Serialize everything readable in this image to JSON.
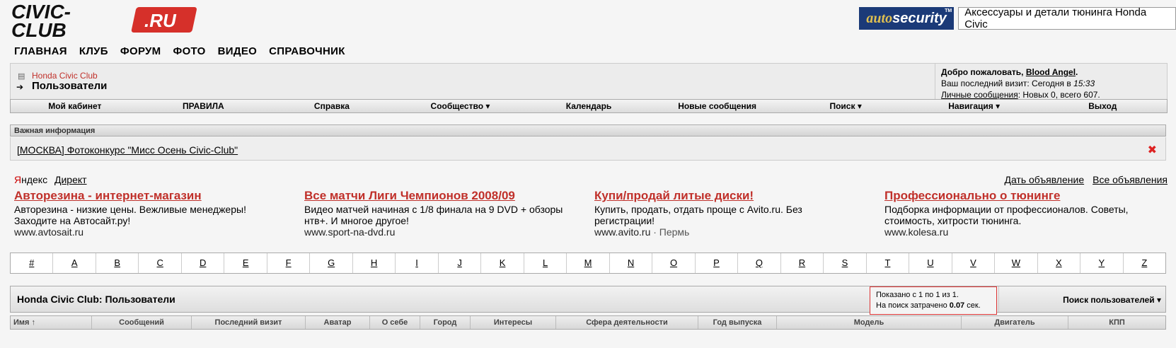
{
  "logo": {
    "line1": "CIVIC-",
    "line2": "CLUB",
    "ru": ".RU"
  },
  "brand": {
    "logo_auto": "auto",
    "logo_security": "security",
    "tm": "TM",
    "text": "Аксессуары и детали тюнинга Honda Civic"
  },
  "topnav": [
    "ГЛАВНАЯ",
    "КЛУБ",
    "ФОРУМ",
    "ФОТО",
    "ВИДЕО",
    "СПРАВОЧНИК"
  ],
  "breadcrumb": {
    "link": "Honda Civic Club",
    "title": "Пользователи"
  },
  "welcome": {
    "greeting": "Добро пожаловать,",
    "user": "Blood Angel",
    "visit_label": "Ваш последний визит: Сегодня в",
    "visit_time": "15:33",
    "pm_label": "Личные сообщения",
    "pm_text": ": Новых 0, всего 607."
  },
  "menubar": [
    "Мой кабинет",
    "ПРАВИЛА",
    "Справка",
    "Сообщество ▾",
    "Календарь",
    "Новые сообщения",
    "Поиск ▾",
    "Навигация ▾",
    "Выход"
  ],
  "info": {
    "header": "Важная информация",
    "text": "[МОСКВА] Фотоконкурс \"Мисс Осень Civic-Club\"",
    "close": "✖"
  },
  "yandex": {
    "y": "Я",
    "ndex": "ндекс",
    "direct": "Директ",
    "give_ad": "Дать объявление",
    "all_ads": "Все объявления"
  },
  "ads": [
    {
      "title": "Авторезина - интернет-магазин",
      "text": "Авторезина - низкие цены. Вежливые менеджеры! Заходите на Автосайт.ру!",
      "url": "www.avtosait.ru",
      "geo": ""
    },
    {
      "title": "Все матчи Лиги Чемпионов 2008/09",
      "text": "Видео матчей начиная с 1/8 финала на 9 DVD + обзоры нтв+. И многое другое!",
      "url": "www.sport-na-dvd.ru",
      "geo": ""
    },
    {
      "title": "Купи/продай литые диски!",
      "text": "Купить, продать, отдать проще с Avito.ru. Без регистрации!",
      "url": "www.avito.ru",
      "geo": " · Пермь"
    },
    {
      "title": "Профессионально о тюнинге",
      "text": "Подборка информации от профессионалов. Советы, стоимость, хитрости тюнинга.",
      "url": "www.kolesa.ru",
      "geo": ""
    }
  ],
  "alphabet": [
    "#",
    "A",
    "B",
    "C",
    "D",
    "E",
    "F",
    "G",
    "H",
    "I",
    "J",
    "K",
    "L",
    "M",
    "N",
    "O",
    "P",
    "Q",
    "R",
    "S",
    "T",
    "U",
    "V",
    "W",
    "X",
    "Y",
    "Z"
  ],
  "users": {
    "title": "Honda Civic Club: Пользователи",
    "shown": "Показано с 1 по 1 из 1.",
    "time_label": "На поиск затрачено",
    "time_value": "0.07",
    "time_unit": "сек.",
    "search": "Поиск пользователей ▾"
  },
  "columns": [
    "Имя ↑",
    "Сообщений",
    "Последний визит",
    "Аватар",
    "О себе",
    "Город",
    "Интересы",
    "Сфера деятельности",
    "Год выпуска",
    "Модель",
    "Двигатель",
    "КПП"
  ]
}
